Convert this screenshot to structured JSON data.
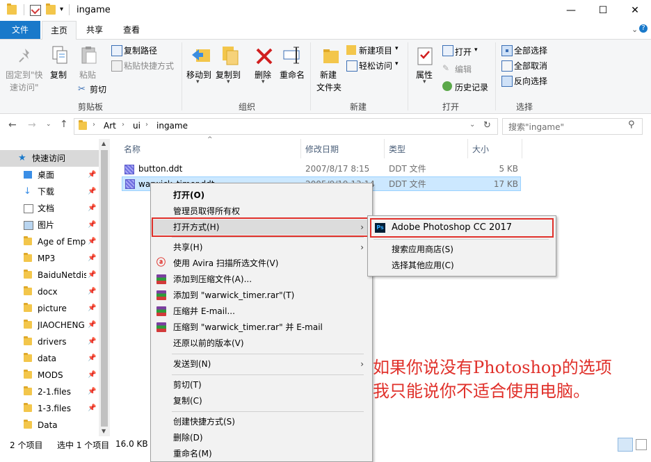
{
  "window": {
    "title": "ingame",
    "minimize": "—",
    "maximize": "☐",
    "close": "✕"
  },
  "tabs": {
    "file": "文件",
    "home": "主页",
    "share": "共享",
    "view": "查看"
  },
  "ribbon": {
    "pin_quick_l1": "固定到\"快",
    "pin_quick_l2": "速访问\"",
    "copy": "复制",
    "paste": "粘贴",
    "copy_path": "复制路径",
    "paste_shortcut": "粘贴快捷方式",
    "cut": "剪切",
    "group_clipboard": "剪贴板",
    "move_to": "移动到",
    "copy_to": "复制到",
    "delete": "删除",
    "rename": "重命名",
    "group_organize": "组织",
    "new_folder_l1": "新建",
    "new_folder_l2": "文件夹",
    "new_item": "新建项目",
    "easy_access": "轻松访问",
    "group_new": "新建",
    "properties": "属性",
    "open": "打开",
    "edit": "编辑",
    "history": "历史记录",
    "group_open": "打开",
    "select_all": "全部选择",
    "select_none": "全部取消",
    "invert": "反向选择",
    "group_select": "选择"
  },
  "address": {
    "crumbs": [
      "Art",
      "ui",
      "ingame"
    ],
    "search_placeholder": "搜索\"ingame\""
  },
  "nav": {
    "quick_access": "快速访问",
    "items": [
      "桌面",
      "下载",
      "文档",
      "图片",
      "Age of Emp",
      "MP3",
      "BaiduNetdis",
      "docx",
      "picture",
      "JIAOCHENG",
      "drivers",
      "data",
      "MODS",
      "2-1.files",
      "1-3.files",
      "Data"
    ]
  },
  "columns": {
    "name": "名称",
    "date": "修改日期",
    "type": "类型",
    "size": "大小"
  },
  "files": [
    {
      "name": "button.ddt",
      "date": "2007/8/17 8:15",
      "type": "DDT 文件",
      "size": "5 KB"
    },
    {
      "name": "warwick_timer.ddt",
      "date": "2005/9/19 13:14",
      "type": "DDT 文件",
      "size": "17 KB"
    }
  ],
  "status": {
    "count": "2 个项目",
    "selected": "选中 1 个项目",
    "size": "16.0 KB"
  },
  "context_menu": {
    "open": "打开(O)",
    "take_ownership": "管理员取得所有权",
    "open_with": "打开方式(H)",
    "share": "共享(H)",
    "avira": "使用 Avira 扫描所选文件(V)",
    "add_archive": "添加到压缩文件(A)...",
    "add_rar": "添加到 \"warwick_timer.rar\"(T)",
    "compress_email": "压缩并 E-mail...",
    "compress_rar_email": "压缩到 \"warwick_timer.rar\" 并 E-mail",
    "restore": "还原以前的版本(V)",
    "send_to": "发送到(N)",
    "cut": "剪切(T)",
    "copy": "复制(C)",
    "create_shortcut": "创建快捷方式(S)",
    "delete": "删除(D)",
    "rename": "重命名(M)"
  },
  "submenu": {
    "photoshop": "Adobe Photoshop CC 2017",
    "ps_icon_text": "Ps",
    "store": "搜索应用商店(S)",
    "other_app": "选择其他应用(C)"
  },
  "annotation": {
    "line1": "如果你说没有Photoshop的选项",
    "line2": "我只能说你不适合使用电脑。"
  },
  "colors": {
    "accent": "#1979ca",
    "annotation_red": "#e0302a",
    "selection": "#cce8ff"
  }
}
